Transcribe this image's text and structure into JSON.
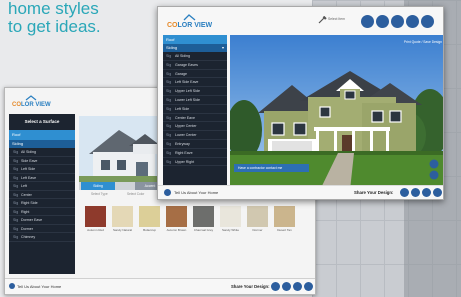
{
  "caption": {
    "line1": "home styles",
    "line2": "to get ideas."
  },
  "front_app": {
    "logo_text": "COLOR VIEW",
    "tool_label": "Select Item",
    "print_label": "Print Quote / Save Design",
    "sidebar": {
      "roof_label": "Roof",
      "siding_label": "Siding",
      "items": [
        {
          "tag": "Sig",
          "label": "All Siding"
        },
        {
          "tag": "Sig",
          "label": "Garage Eaves"
        },
        {
          "tag": "Sig",
          "label": "Garage"
        },
        {
          "tag": "Sig",
          "label": "Left Side Eave"
        },
        {
          "tag": "Sig",
          "label": "Upper Left Side"
        },
        {
          "tag": "Sig",
          "label": "Lower Left Side"
        },
        {
          "tag": "Sig",
          "label": "Left Side"
        },
        {
          "tag": "Sig",
          "label": "Center Eave"
        },
        {
          "tag": "Sig",
          "label": "Upper Center"
        },
        {
          "tag": "Sig",
          "label": "Lower Center"
        },
        {
          "tag": "Sig",
          "label": "Entryway"
        },
        {
          "tag": "Sig",
          "label": "Right Eave"
        },
        {
          "tag": "Sig",
          "label": "Upper Right"
        }
      ]
    },
    "contact_label": "Have a contractor contact me",
    "tell_us": "Tell Us About Your Home",
    "share_label": "Share Your Design:"
  },
  "back_app": {
    "logo_text": "COLOR VIEW",
    "sidebar_title": "Select a Surface",
    "roof_label": "Roof",
    "siding_label": "Siding",
    "items": [
      {
        "tag": "Sig",
        "label": "All Siding"
      },
      {
        "tag": "Sig",
        "label": "Side Eave"
      },
      {
        "tag": "Sig",
        "label": "Left Side"
      },
      {
        "tag": "Sig",
        "label": "Left Eave"
      },
      {
        "tag": "Sig",
        "label": "Left"
      },
      {
        "tag": "Sig",
        "label": "Center"
      },
      {
        "tag": "Sig",
        "label": "Right Side"
      },
      {
        "tag": "Sig",
        "label": "Right"
      },
      {
        "tag": "Sig",
        "label": "Dormer Eave"
      },
      {
        "tag": "Sig",
        "label": "Dormer"
      },
      {
        "tag": "Sig",
        "label": "Chimney"
      }
    ],
    "tabs": [
      "Siding",
      "Accent"
    ],
    "filters": [
      "Select Type",
      "Select Color"
    ],
    "swatches": [
      {
        "label": "Autumn Red",
        "color": "#8e3a2c"
      },
      {
        "label": "Sandy Natural",
        "color": "#e4d8b6"
      },
      {
        "label": "Buttercup",
        "color": "#dccf98"
      },
      {
        "label": "Autumn Brown",
        "color": "#a66e45"
      },
      {
        "label": "Charcoal Grey",
        "color": "#6d6e6c"
      },
      {
        "label": "Sandy White",
        "color": "#e9e6dc"
      },
      {
        "label": "Dormer",
        "color": "#d1c8b0"
      },
      {
        "label": "Desert Tan",
        "color": "#cbb58d"
      }
    ],
    "tell_us": "Tell Us About Your Home",
    "share_label": "Share Your Design:"
  },
  "colors": {
    "accent": "#2aa7b8",
    "sidebar_bg": "#1c2430",
    "selected_blue": "#2f8fd1"
  }
}
